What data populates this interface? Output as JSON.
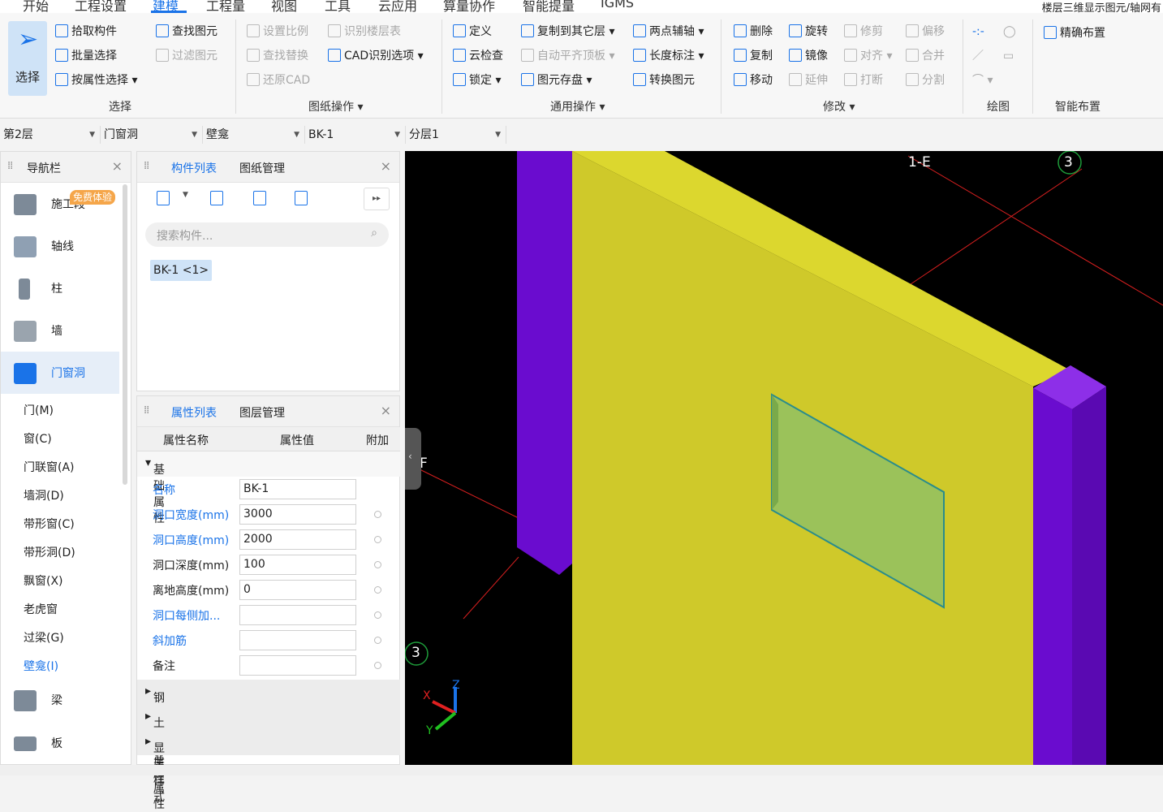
{
  "menu": {
    "items": [
      "开始",
      "工程设置",
      "建模",
      "工程量",
      "视图",
      "工具",
      "云应用",
      "算量协作",
      "智能提量",
      "IGMS"
    ],
    "active_index": 2,
    "window_title": "楼层三维显示图元/轴网有"
  },
  "ribbon": {
    "select_big_label": "选择",
    "select_group": {
      "pick": "拾取构件",
      "batch": "批量选择",
      "by_attr": "按属性选择",
      "find": "查找图元",
      "filter": "过滤图元",
      "name": "选择"
    },
    "drawing_group": {
      "scale": "设置比例",
      "floors": "识别楼层表",
      "replace": "查找替换",
      "cad_opts": "CAD识别选项",
      "restore": "还原CAD",
      "name": "图纸操作"
    },
    "common_group": {
      "define": "定义",
      "copy_layer": "复制到其它层",
      "two_pt_axis": "两点辅轴",
      "cloud_check": "云检查",
      "auto_align": "自动平齐顶板",
      "len_mark": "长度标注",
      "lock": "锁定",
      "save_elem": "图元存盘",
      "convert": "转换图元",
      "name": "通用操作"
    },
    "modify_group": {
      "delete": "删除",
      "rotate": "旋转",
      "trim": "修剪",
      "offset": "偏移",
      "copy": "复制",
      "mirror": "镜像",
      "align": "对齐",
      "merge": "合并",
      "move": "移动",
      "extend": "延伸",
      "break": "打断",
      "split": "分割",
      "name": "修改"
    },
    "draw_group": {
      "name": "绘图"
    },
    "smart_group": {
      "precise": "精确布置",
      "name": "智能布置"
    }
  },
  "toolbar2": {
    "floor": "第2层",
    "category": "门窗洞",
    "type": "壁龛",
    "component": "BK-1",
    "layer": "分层1"
  },
  "nav": {
    "title": "导航栏",
    "badge": "免费体验",
    "items": [
      {
        "label": "施工段"
      },
      {
        "label": "轴线"
      },
      {
        "label": "柱"
      },
      {
        "label": "墙"
      },
      {
        "label": "门窗洞"
      }
    ],
    "sub_items": [
      "门(M)",
      "窗(C)",
      "门联窗(A)",
      "墙洞(D)",
      "带形窗(C)",
      "带形洞(D)",
      "飘窗(X)",
      "老虎窗",
      "过梁(G)",
      "壁龛(I)"
    ],
    "bottom_items": [
      {
        "label": "梁"
      },
      {
        "label": "板"
      }
    ]
  },
  "components": {
    "tabs": [
      "构件列表",
      "图纸管理"
    ],
    "search_placeholder": "搜索构件...",
    "selected": "BK-1 <1>"
  },
  "properties": {
    "tabs": [
      "属性列表",
      "图层管理"
    ],
    "headers": [
      "属性名称",
      "属性值",
      "附加"
    ],
    "section_basic": "基础属性",
    "rows": [
      {
        "name": "名称",
        "value": "BK-1"
      },
      {
        "name": "洞口宽度(mm)",
        "value": "3000"
      },
      {
        "name": "洞口高度(mm)",
        "value": "2000"
      },
      {
        "name": "洞口深度(mm)",
        "value": "100"
      },
      {
        "name": "离地高度(mm)",
        "value": "0"
      },
      {
        "name": "洞口每侧加...",
        "value": ""
      },
      {
        "name": "斜加筋",
        "value": ""
      },
      {
        "name": "备注",
        "value": ""
      }
    ],
    "sections": [
      "钢筋业务属性",
      "土建业务属性",
      "显示样式"
    ]
  },
  "viewport": {
    "axis_labels": [
      "1-E",
      "3",
      "F",
      "3"
    ],
    "coord_x": "X",
    "coord_y": "Y",
    "coord_z": "Z",
    "colors": {
      "wall": "#cfc92a",
      "column": "#6a0ccf",
      "niche": "#9bc25a",
      "axis": "#d61f1f",
      "background": "#000000"
    }
  }
}
